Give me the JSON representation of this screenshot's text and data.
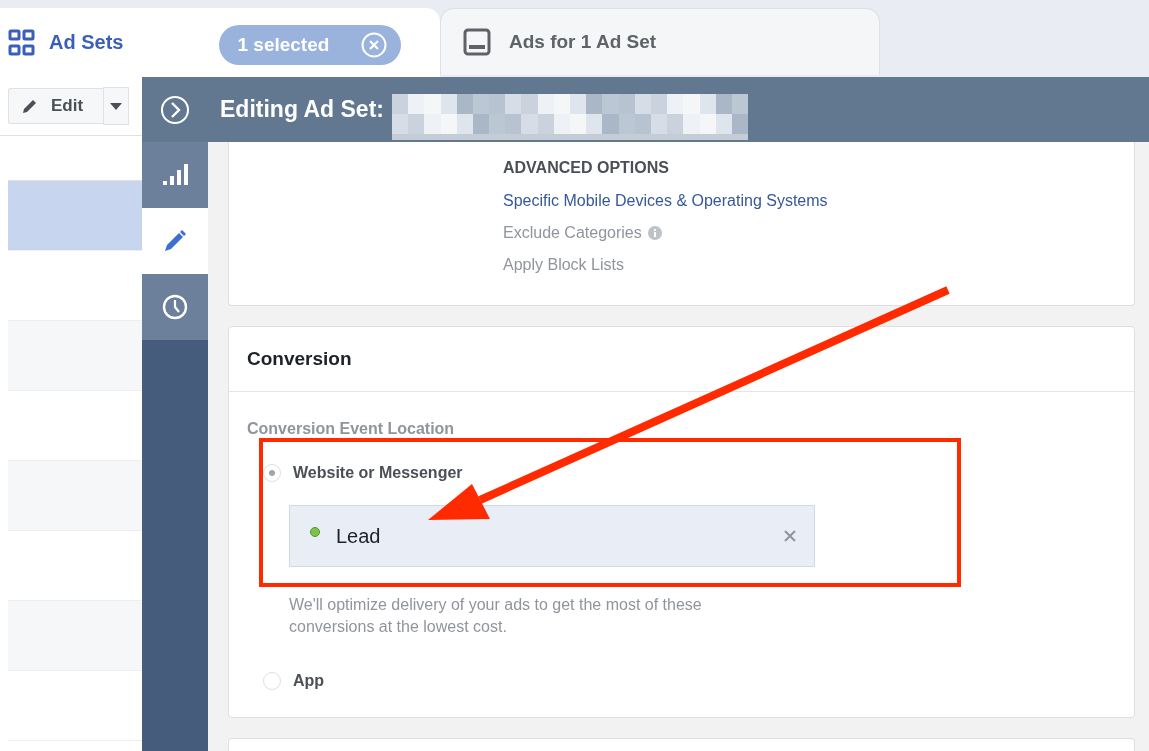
{
  "top_bar": {
    "title": "Ad Sets",
    "selection": "1 selected",
    "tabs": [
      {
        "label": "Ads for 1 Ad Set",
        "selected": false
      }
    ]
  },
  "toolbar": {
    "edit_button": "Edit"
  },
  "table": {
    "rows": [
      {
        "selected": true
      },
      {
        "selected": false
      },
      {
        "selected": false
      },
      {
        "selected": false
      },
      {
        "selected": false
      },
      {
        "selected": false
      },
      {
        "selected": false
      },
      {
        "selected": false
      }
    ]
  },
  "panel": {
    "title": "Editing Ad Set:",
    "nav": [
      {
        "kind": "stats",
        "selected": false
      },
      {
        "kind": "edit",
        "selected": true
      },
      {
        "kind": "history",
        "selected": false
      }
    ],
    "advanced_options": {
      "heading": "ADVANCED OPTIONS",
      "items": [
        {
          "label": "Specific Mobile Devices & Operating Systems",
          "kind": "link"
        },
        {
          "label": "Exclude Categories",
          "kind": "info"
        },
        {
          "label": "Apply Block Lists",
          "kind": "plain"
        }
      ]
    },
    "conversion": {
      "heading": "Conversion",
      "field_label": "Conversion Event Location",
      "options": [
        {
          "label": "Website or Messenger",
          "selected": true
        },
        {
          "label": "App",
          "selected": false
        }
      ],
      "event": {
        "label": "Lead",
        "color": "#7dc24b"
      },
      "help": "We'll optimize delivery of your ads to get the most of these conversions at the lowest cost."
    }
  }
}
